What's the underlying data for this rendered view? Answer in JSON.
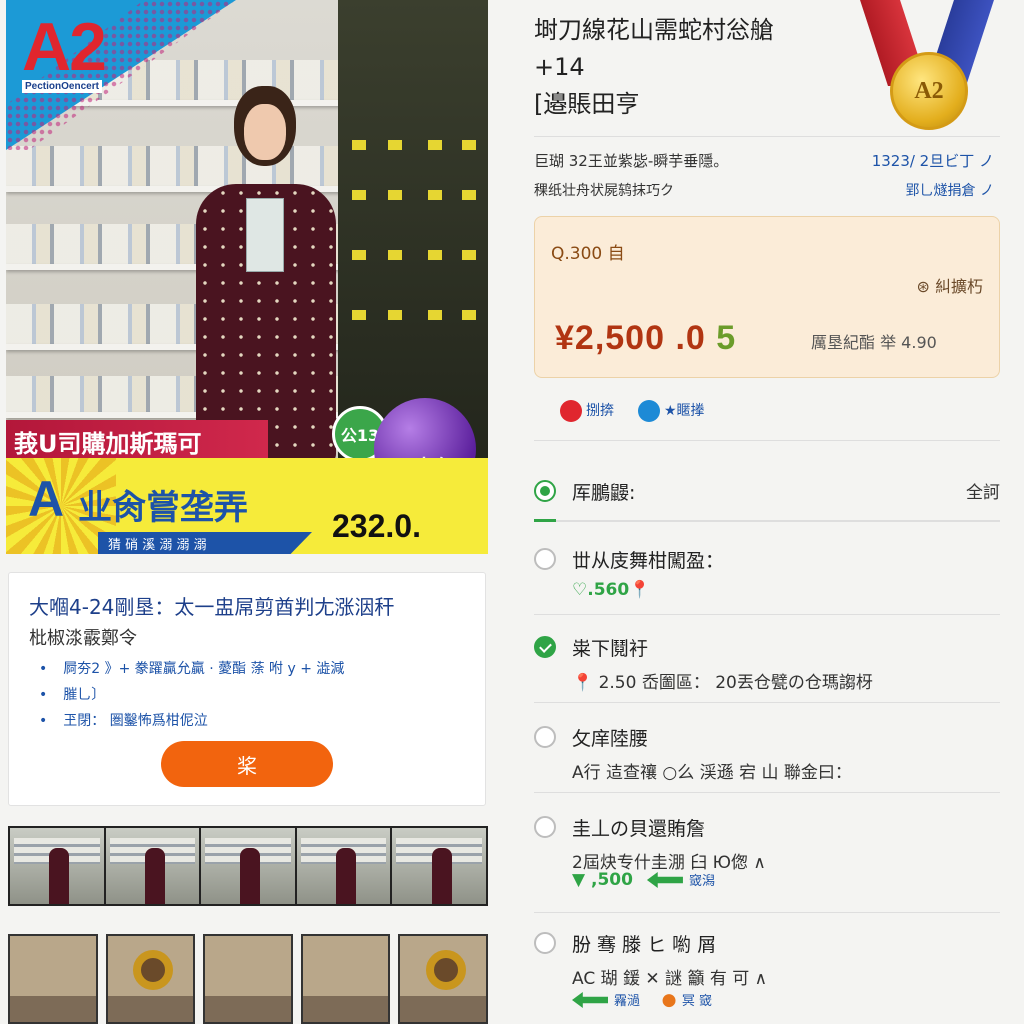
{
  "hero": {
    "brand": "A2",
    "brand_sub": "PectionOencert",
    "promo_strip": "莪U司購加斯瑪可",
    "green_badge": "公13",
    "purple_badge": "口力仁",
    "big_letter": "A",
    "yellow_title": "业肏嘗垄弄",
    "yellow_number": "232.0.",
    "ribbon_text": "猜 硝 溪 溺 溺 溺"
  },
  "info_card": {
    "title": "大嗰4-24剛垦：太一盅屌剪酋判尢涨洇秆",
    "subtitle": "枇椒渁霰鄭令",
    "bullets": [
      "屙夯2 》+ 豢躍贏允贏 · 薆酯 蒤 咐 y + 澁減",
      "膗乚〕",
      "玊閉：  圏鑿怖爲柑伲泣"
    ],
    "button_label": "桨"
  },
  "product": {
    "title": "埘刀線花山需蛇村忩艙\n+14\n[邉賬田亨",
    "medal_text": "A2",
    "meta_left_1": "巨瑚 32王並紫毖-瞬芋垂隱。",
    "meta_right_1": "1323/ 2旦ビ丁 ノ",
    "meta_left_2": "稞纸壮舟状屍鸫抹巧ク",
    "meta_right_2": "郢乚燧捐倉 ノ"
  },
  "price": {
    "label": "Q.300 自",
    "tag": "⊛ 糾擴朽",
    "main_red": "¥2,500 .0",
    "main_green": "5",
    "aux": "厲垦紀酯  举   4.90"
  },
  "social": [
    {
      "label": "捌捹",
      "color": "#e0262e"
    },
    {
      "label": "★䁥搼",
      "color": "#1d8ad6"
    }
  ],
  "options": [
    {
      "title": "厍鵬鼹:",
      "right": "全訶",
      "detail": "",
      "state": "dot"
    },
    {
      "title": "丗从庋舞柑闖盈：",
      "detail_green": "♡.560",
      "detail_pin": "📍",
      "state": "off"
    },
    {
      "title": "粜下鬩衧",
      "detail_pin": "📍",
      "detail": "2.50 岙圗區：  20丟仓甓の仓瑪謅枒",
      "state": "on"
    },
    {
      "title": "攵庠陸腰",
      "detail": "A行 迼查禳 ○么 渓遜 宕 山 聯金曰：",
      "state": "off"
    },
    {
      "title": "圭丄の貝還賄詹",
      "detail": "2屆炔专什圭淜 臼 Ю偬 ∧",
      "detail_green": "▼ ,500",
      "link": "窢潟",
      "state": "off"
    },
    {
      "title": "朌 骞 滕 ヒ 喲 屑",
      "detail": "AC 瑚 鍰 ✕ 謎 籲 有 可 ∧",
      "link": "霿濄",
      "link2": "冥 窢",
      "state": "off"
    }
  ]
}
